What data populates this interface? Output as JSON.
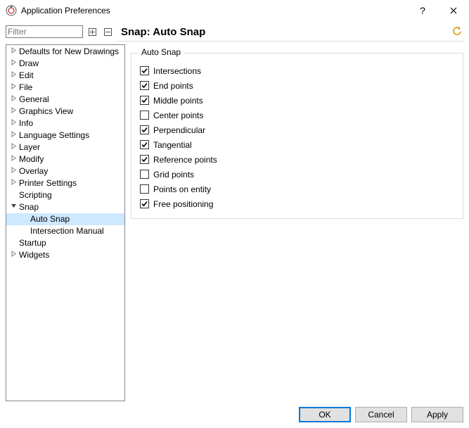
{
  "window": {
    "title": "Application Preferences"
  },
  "filter": {
    "placeholder": "Filter"
  },
  "heading": "Snap: Auto Snap",
  "tree": [
    {
      "label": "Defaults for New Drawings",
      "depth": 0,
      "expandable": true,
      "expanded": false,
      "selected": false
    },
    {
      "label": "Draw",
      "depth": 0,
      "expandable": true,
      "expanded": false,
      "selected": false
    },
    {
      "label": "Edit",
      "depth": 0,
      "expandable": true,
      "expanded": false,
      "selected": false
    },
    {
      "label": "File",
      "depth": 0,
      "expandable": true,
      "expanded": false,
      "selected": false
    },
    {
      "label": "General",
      "depth": 0,
      "expandable": true,
      "expanded": false,
      "selected": false
    },
    {
      "label": "Graphics View",
      "depth": 0,
      "expandable": true,
      "expanded": false,
      "selected": false
    },
    {
      "label": "Info",
      "depth": 0,
      "expandable": true,
      "expanded": false,
      "selected": false
    },
    {
      "label": "Language Settings",
      "depth": 0,
      "expandable": true,
      "expanded": false,
      "selected": false
    },
    {
      "label": "Layer",
      "depth": 0,
      "expandable": true,
      "expanded": false,
      "selected": false
    },
    {
      "label": "Modify",
      "depth": 0,
      "expandable": true,
      "expanded": false,
      "selected": false
    },
    {
      "label": "Overlay",
      "depth": 0,
      "expandable": true,
      "expanded": false,
      "selected": false
    },
    {
      "label": "Printer Settings",
      "depth": 0,
      "expandable": true,
      "expanded": false,
      "selected": false
    },
    {
      "label": "Scripting",
      "depth": 0,
      "expandable": false,
      "expanded": false,
      "selected": false
    },
    {
      "label": "Snap",
      "depth": 0,
      "expandable": true,
      "expanded": true,
      "selected": false
    },
    {
      "label": "Auto Snap",
      "depth": 1,
      "expandable": false,
      "expanded": false,
      "selected": true
    },
    {
      "label": "Intersection Manual",
      "depth": 1,
      "expandable": false,
      "expanded": false,
      "selected": false
    },
    {
      "label": "Startup",
      "depth": 0,
      "expandable": false,
      "expanded": false,
      "selected": false
    },
    {
      "label": "Widgets",
      "depth": 0,
      "expandable": true,
      "expanded": false,
      "selected": false
    }
  ],
  "group": {
    "title": "Auto Snap",
    "options": [
      {
        "label": "Intersections",
        "checked": true
      },
      {
        "label": "End points",
        "checked": true
      },
      {
        "label": "Middle points",
        "checked": true
      },
      {
        "label": "Center points",
        "checked": false
      },
      {
        "label": "Perpendicular",
        "checked": true
      },
      {
        "label": "Tangential",
        "checked": true
      },
      {
        "label": "Reference points",
        "checked": true
      },
      {
        "label": "Grid points",
        "checked": false
      },
      {
        "label": "Points on entity",
        "checked": false
      },
      {
        "label": "Free positioning",
        "checked": true
      }
    ]
  },
  "buttons": {
    "ok": "OK",
    "cancel": "Cancel",
    "apply": "Apply"
  }
}
